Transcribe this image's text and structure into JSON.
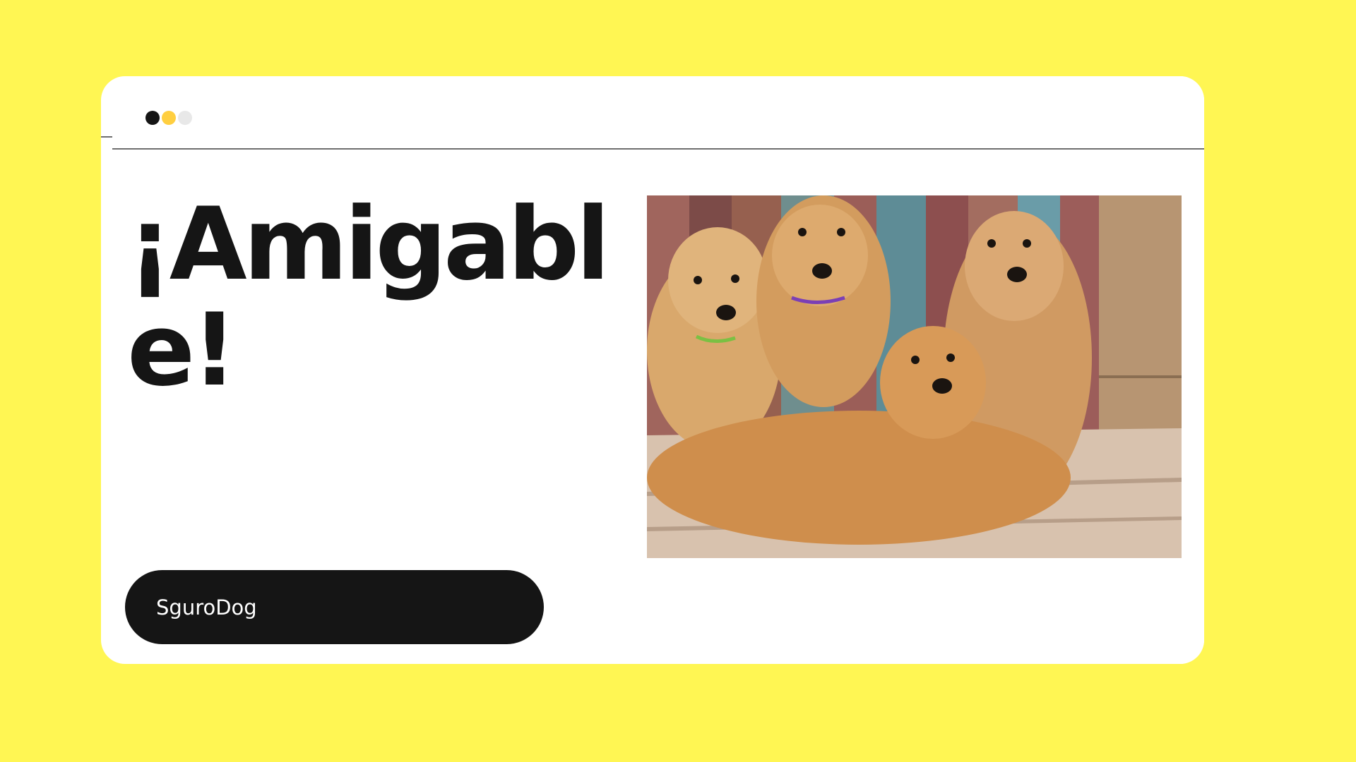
{
  "slide": {
    "heading": "¡Amigable!",
    "button_label": "SguroDog",
    "photo_subject": "puppies-photo"
  },
  "window_dots": [
    {
      "color": "#151515"
    },
    {
      "color": "#FFCF40"
    },
    {
      "color": "#E8E8E8"
    }
  ],
  "colors": {
    "background": "#FFF653",
    "card": "#FFFFFF",
    "text": "#151515",
    "button": "#151515",
    "button_text": "#FFFFFF"
  }
}
